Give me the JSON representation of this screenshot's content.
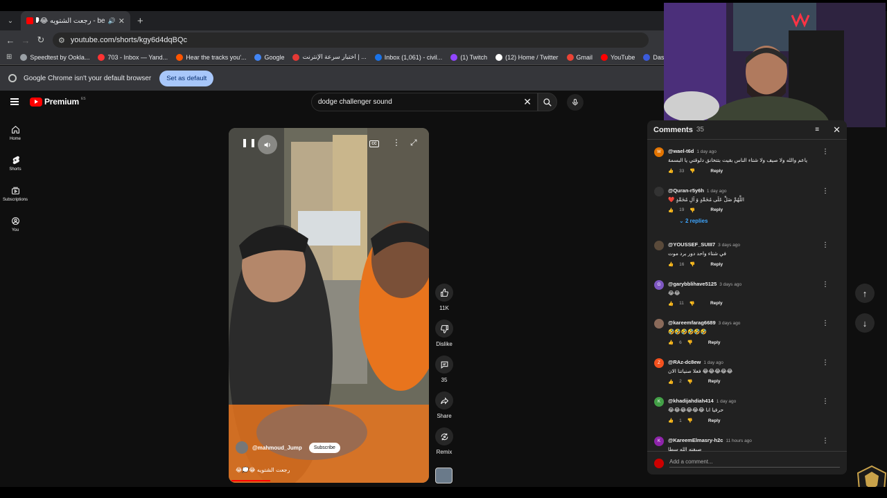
{
  "browser": {
    "tab_title": "رجعت الشتويه 😂💭😂",
    "tab_prefix": "be -",
    "address": "youtube.com/shorts/kgy6d4dqBQc",
    "bookmarks": [
      {
        "label": "Speedtest by Ookla...",
        "color": "#9aa0a6"
      },
      {
        "label": "703 - Inbox — Yand...",
        "color": "#ff3333"
      },
      {
        "label": "Hear the tracks you'...",
        "color": "#ff5500"
      },
      {
        "label": "Google",
        "color": "#4285f4"
      },
      {
        "label": "اختبار سرعة الإنترنت | ...",
        "color": "#e53935"
      },
      {
        "label": "Inbox (1,061) - civil...",
        "color": "#1a73e8"
      },
      {
        "label": "(1) Twitch",
        "color": "#9146ff"
      },
      {
        "label": "(12) Home / Twitter",
        "color": "#ffffff"
      },
      {
        "label": "Gmail",
        "color": "#ea4335"
      },
      {
        "label": "YouTube",
        "color": "#ff0000"
      },
      {
        "label": "Dashboard - Restre...",
        "color": "#3b5bdb"
      }
    ],
    "infobar_message": "Google Chrome isn't your default browser",
    "infobar_button": "Set as default"
  },
  "youtube": {
    "logo_text": "Premium",
    "logo_region": "ES",
    "search_value": "dodge challenger sound",
    "nav": [
      {
        "label": "Home",
        "icon": "home-icon"
      },
      {
        "label": "Shorts",
        "icon": "shorts-icon"
      },
      {
        "label": "Subscriptions",
        "icon": "subscriptions-icon"
      },
      {
        "label": "You",
        "icon": "you-icon"
      }
    ]
  },
  "short": {
    "channel": "@mahmoud_Jump",
    "subscribe_label": "Subscribe",
    "title": "رجعت الشتويه 😂💭😂",
    "likes": "11K",
    "dislike_label": "Dislike",
    "comments_count": "35",
    "share_label": "Share",
    "remix_label": "Remix",
    "progress": 0.2
  },
  "comments_panel": {
    "title": "Comments",
    "count": "35",
    "add_placeholder": "Add a comment...",
    "reply_label": "Reply",
    "items": [
      {
        "author": "@wael-t6d",
        "time": "1 day ago",
        "text": "ياعم والله ولا صيف ولا شتاء الناس بقيت بتتخانق دلوقتي يا البسمة",
        "likes": "33",
        "avatar": "W",
        "color": "#e37400"
      },
      {
        "author": "@Quran-r5y6h",
        "time": "1 day ago",
        "text": "اللَّهُمَّ صَلِّ عَلَى مُحَمَّدٍ وَ آلِ مُحَمَّدٍ ❤️",
        "likes": "19",
        "avatar": "",
        "color": "#333333",
        "replies": "2 replies"
      },
      {
        "author": "@YOUSSEF_SUIII7",
        "time": "3 days ago",
        "text": "في شتاء واحد دور برد موت",
        "likes": "16",
        "avatar": "",
        "color": "#5a4a3a"
      },
      {
        "author": "@garybblihave5125",
        "time": "3 days ago",
        "text": "😂😂",
        "likes": "11",
        "avatar": "G",
        "color": "#7e57c2"
      },
      {
        "author": "@kareemfarag6689",
        "time": "3 days ago",
        "text": "🤣🤣🤣🤣🤣🤣",
        "likes": "6",
        "avatar": "",
        "color": "#8a6a5a"
      },
      {
        "author": "@RAz-dc8ew",
        "time": "1 day ago",
        "text": "😂😂😂😂😂 فعلا صنياتنا الان",
        "likes": "2",
        "avatar": "Z",
        "color": "#f4511e"
      },
      {
        "author": "@khadijahdiah414",
        "time": "1 day ago",
        "text": "حرفيا انا 😂😂😂😂😂😂",
        "likes": "1",
        "avatar": "K",
        "color": "#43a047"
      },
      {
        "author": "@KareemElmasry-h2c",
        "time": "11 hours ago",
        "text": "صيفنه الله سطا",
        "likes": "",
        "avatar": "K",
        "color": "#8e24aa"
      }
    ]
  }
}
